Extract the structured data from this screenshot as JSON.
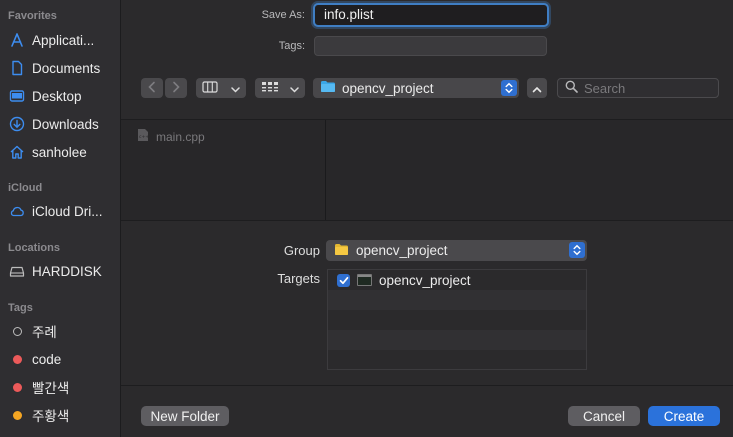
{
  "sidebar": {
    "favorites_title": "Favorites",
    "favorites": [
      {
        "label": "Applicati...",
        "icon": "applications-icon"
      },
      {
        "label": "Documents",
        "icon": "document-icon"
      },
      {
        "label": "Desktop",
        "icon": "desktop-icon"
      },
      {
        "label": "Downloads",
        "icon": "download-icon"
      },
      {
        "label": "sanholee",
        "icon": "home-icon"
      }
    ],
    "icloud_title": "iCloud",
    "icloud": [
      {
        "label": "iCloud Dri...",
        "icon": "cloud-icon"
      }
    ],
    "locations_title": "Locations",
    "locations": [
      {
        "label": "HARDDISK",
        "icon": "harddisk-icon"
      }
    ],
    "tags_title": "Tags",
    "tags": [
      {
        "label": "주례",
        "color": "hollow"
      },
      {
        "label": "code",
        "color": "#ec5a5a"
      },
      {
        "label": "빨간색",
        "color": "#ec5a5a"
      },
      {
        "label": "주황색",
        "color": "#f5a623"
      }
    ]
  },
  "form": {
    "save_as_label": "Save As:",
    "save_as_value": "info.plist",
    "tags_label": "Tags:",
    "tags_value": ""
  },
  "toolbar": {
    "location": "opencv_project",
    "search_placeholder": "Search"
  },
  "browser": {
    "files": [
      {
        "name": "main.cpp",
        "icon": "cpp-file-icon"
      }
    ]
  },
  "options": {
    "group_label": "Group",
    "group_value": "opencv_project",
    "targets_label": "Targets",
    "targets": [
      {
        "name": "opencv_project",
        "checked": true
      }
    ]
  },
  "footer": {
    "new_folder": "New Folder",
    "cancel": "Cancel",
    "create": "Create"
  },
  "colors": {
    "accent": "#2b72db",
    "folder": "#3aa7e8",
    "group_folder": "#f5c842"
  }
}
